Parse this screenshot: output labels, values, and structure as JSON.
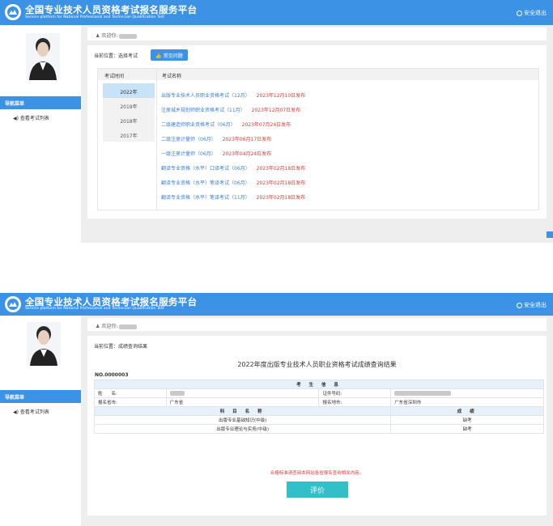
{
  "app": {
    "title": "全国专业技术人员资格考试报名服务平台",
    "subtitle": "Service platform for National Professional and Technician Qualification Test",
    "logout_label": "安全退出"
  },
  "sidebar": {
    "menu_head": "导航菜单",
    "menu_item": "查看考试列表"
  },
  "screen1": {
    "welcome": "欢迎你:",
    "breadcrumb": "当前位置：选择考试",
    "faq_button": "常见问题",
    "col_time": "考试时间",
    "col_name": "考试名称",
    "years": [
      "2022年",
      "2019年",
      "2018年",
      "2017年"
    ],
    "exams": [
      {
        "name": "出版专业技术人员职业资格考试（12月）",
        "date": "2023年12月10日发布"
      },
      {
        "name": "注册城乡规划师职业资格考试（11月）",
        "date": "2023年12月07日发布"
      },
      {
        "name": "二级建造师职业资格考试（06月）",
        "date": "2023年07月24日发布"
      },
      {
        "name": "二级注册计量师（06月）",
        "date": "2023年06月17日发布"
      },
      {
        "name": "一级注册计量师（06月）",
        "date": "2023年04月24日发布"
      },
      {
        "name": "翻译专业资格（水平）口译考试（06月）",
        "date": "2023年02月18日发布"
      },
      {
        "name": "翻译专业资格（水平）笔译考试（06月）",
        "date": "2023年02月18日发布"
      },
      {
        "name": "翻译专业资格（水平）笔译考试（11月）",
        "date": "2023年02月18日发布"
      }
    ]
  },
  "screen2": {
    "welcome": "欢迎你:",
    "breadcrumb": "当前位置：成绩查询结果",
    "result_title": "2022年度出版专业技术人员职业资格考试成绩查询结果",
    "doc_no": "NO.0000003",
    "section_info": "考 生 信 息",
    "name_label": "姓　　名:",
    "id_label": "证件号码:",
    "province_label": "报名省市:",
    "province_value": "广东省",
    "city_label": "报名地市:",
    "city_value": "广东省深圳市",
    "subject_header": "科 目 名 称",
    "score_header": "成 绩",
    "subjects": [
      {
        "name": "出版专业基础知识(中级)",
        "score": "缺考"
      },
      {
        "name": "出版专业理论与实务(中级)",
        "score": "缺考"
      }
    ],
    "notice": "合格标准请查阅本网站各省报名查询相关内容。",
    "eval_button": "评价"
  }
}
